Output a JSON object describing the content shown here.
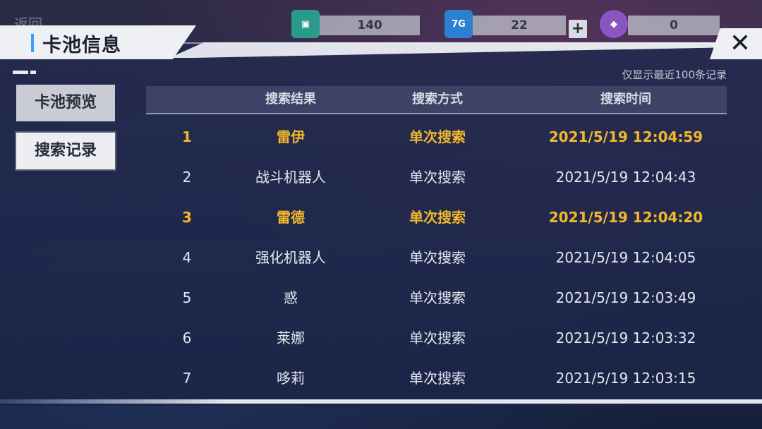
{
  "top_bar": {
    "back_label": "返回",
    "resources": [
      {
        "icon": "chip-card-icon",
        "value": "140"
      },
      {
        "icon": "memory-7g-icon",
        "icon_text": "7G",
        "value": "22"
      },
      {
        "icon": "purple-crystal-icon",
        "value": "0"
      }
    ]
  },
  "panel": {
    "title": "卡池信息",
    "close_symbol": "✕",
    "note": "仅显示最近100条记录"
  },
  "side_tabs": [
    {
      "label": "卡池预览",
      "active": false
    },
    {
      "label": "搜索记录",
      "active": true
    }
  ],
  "table": {
    "headers": [
      "搜索结果",
      "搜索方式",
      "搜索时间"
    ],
    "rows": [
      {
        "index": "1",
        "result": "雷伊",
        "method": "单次搜索",
        "time": "2021/5/19  12:04:59",
        "highlight": true
      },
      {
        "index": "2",
        "result": "战斗机器人",
        "method": "单次搜索",
        "time": "2021/5/19  12:04:43",
        "highlight": false
      },
      {
        "index": "3",
        "result": "雷德",
        "method": "单次搜索",
        "time": "2021/5/19  12:04:20",
        "highlight": true
      },
      {
        "index": "4",
        "result": "强化机器人",
        "method": "单次搜索",
        "time": "2021/5/19  12:04:05",
        "highlight": false
      },
      {
        "index": "5",
        "result": "惑",
        "method": "单次搜索",
        "time": "2021/5/19  12:03:49",
        "highlight": false
      },
      {
        "index": "6",
        "result": "莱娜",
        "method": "单次搜索",
        "time": "2021/5/19  12:03:32",
        "highlight": false
      },
      {
        "index": "7",
        "result": "哆莉",
        "method": "单次搜索",
        "time": "2021/5/19  12:03:15",
        "highlight": false
      }
    ]
  },
  "colors": {
    "highlight": "#f2b82a",
    "accent_blue": "#3aa0ff",
    "panel_bg": "#242a4e"
  }
}
